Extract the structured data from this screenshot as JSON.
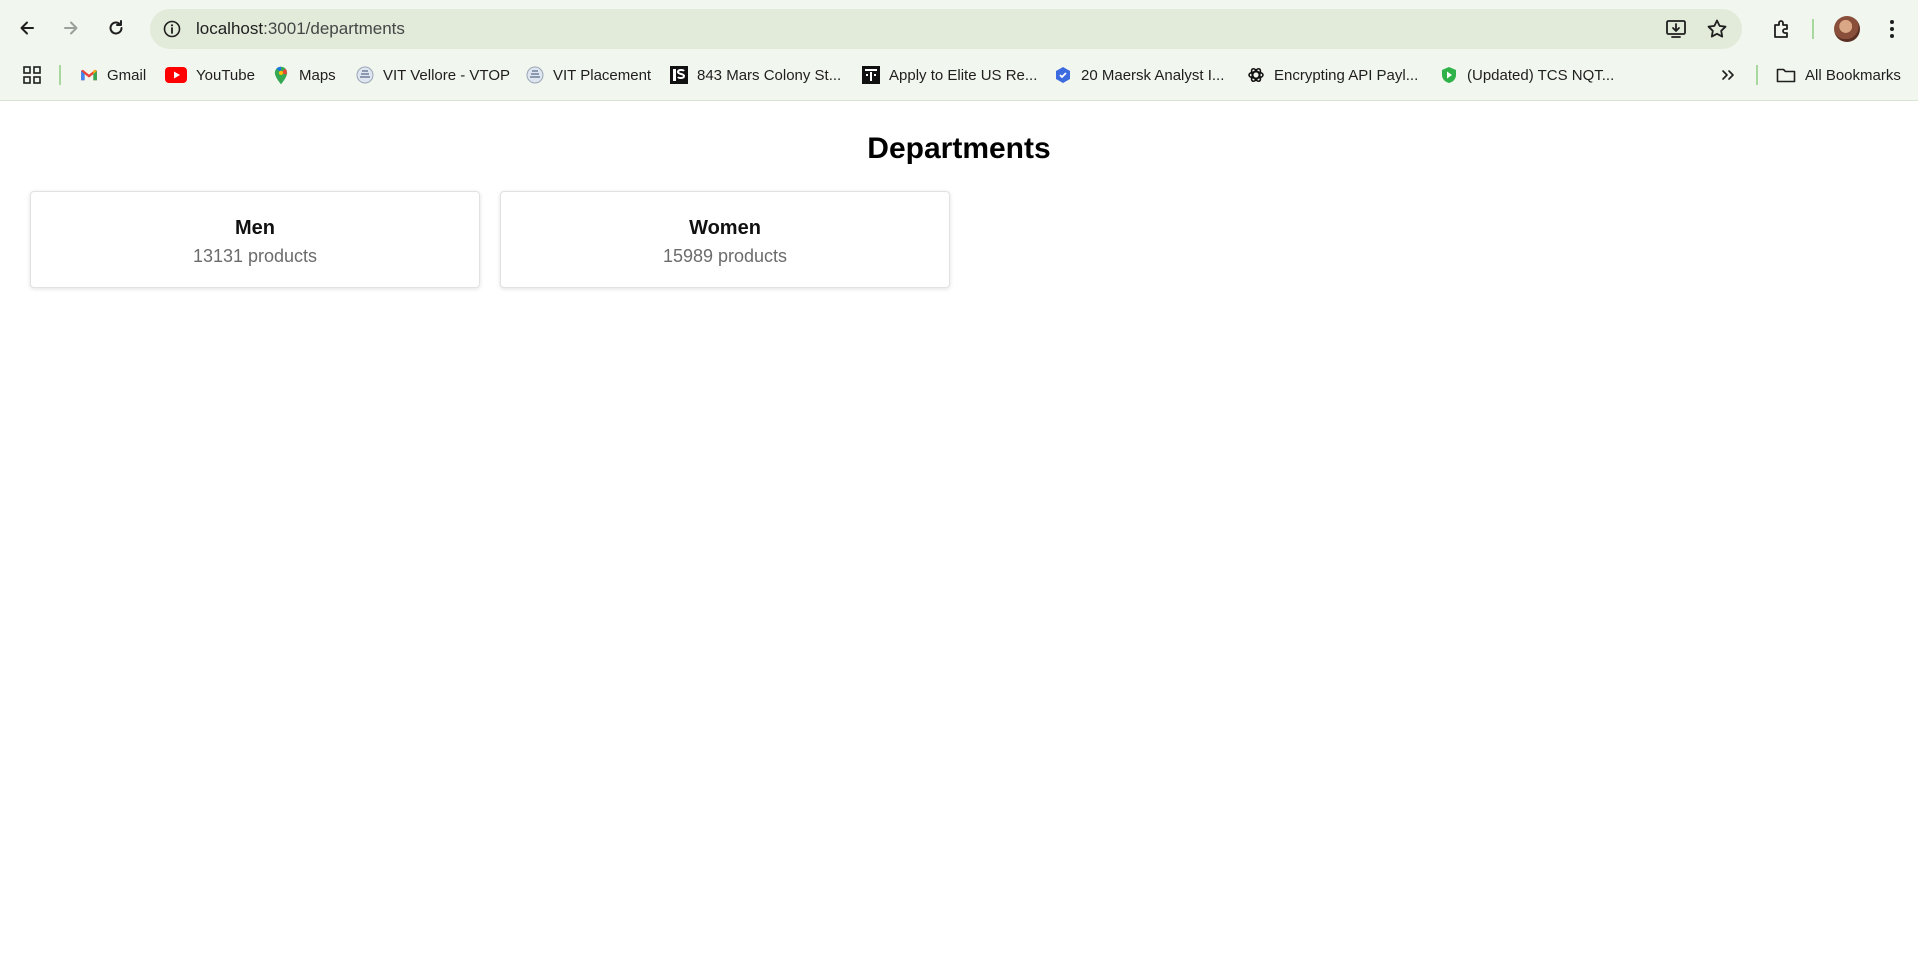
{
  "browser": {
    "url_host": "localhost",
    "url_path": ":3001/departments",
    "bookmarks": [
      {
        "label": "Gmail",
        "icon": "gmail-icon"
      },
      {
        "label": "YouTube",
        "icon": "youtube-icon"
      },
      {
        "label": "Maps",
        "icon": "maps-icon"
      },
      {
        "label": "VIT Vellore - VTOP",
        "icon": "vit-icon"
      },
      {
        "label": "VIT Placement",
        "icon": "vit-icon"
      },
      {
        "label": "843 Mars Colony St...",
        "icon": "is-icon"
      },
      {
        "label": "Apply to Elite US Re...",
        "icon": "apply-icon"
      },
      {
        "label": "20 Maersk Analyst I...",
        "icon": "maersk-icon"
      },
      {
        "label": "Encrypting API Payl...",
        "icon": "openai-icon"
      },
      {
        "label": "(Updated) TCS NQT...",
        "icon": "shield-icon"
      }
    ],
    "all_bookmarks": "All Bookmarks"
  },
  "page": {
    "title": "Departments",
    "departments": [
      {
        "name": "Men",
        "count": "13131 products"
      },
      {
        "name": "Women",
        "count": "15989 products"
      }
    ]
  },
  "colors": {
    "toolbar_bg": "#f1f6ee",
    "omnibox_bg": "#e2ead9",
    "youtube_red": "#ff0000",
    "maersk_blue": "#3c6bdf",
    "tcs_green": "#2fb24a"
  }
}
